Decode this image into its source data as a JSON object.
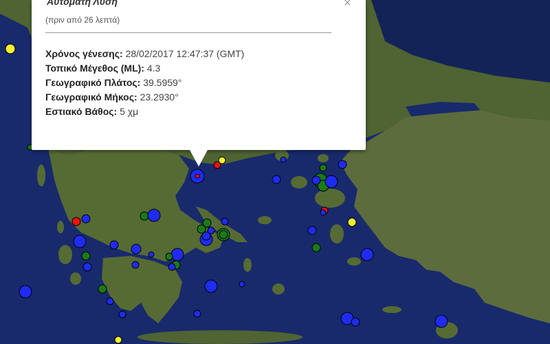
{
  "popup": {
    "title": "Αυτόματη Λύση",
    "subtitle": "(πριν από 26 λεπτά)",
    "close_icon": "close-icon",
    "fields": [
      {
        "label": "Χρόνος γένεσης:",
        "value": "28/02/2017  12:47:37 (GMT)"
      },
      {
        "label": "Τοπικό Μέγεθος (ML):",
        "value": "4.3"
      },
      {
        "label": "Γεωγραφικό Πλάτος:",
        "value": "39.5959°"
      },
      {
        "label": "Γεωγραφικό Μήκος:",
        "value": "23.2930°"
      },
      {
        "label": "Εστιακό Βάθος:",
        "value": "5 χμ"
      }
    ]
  },
  "colors": {
    "sea": "#1a2a6c",
    "land": "#5c6e3a",
    "marker_blue": "#1f2bf2",
    "marker_green": "#1a7a1a",
    "marker_red": "#ee1111",
    "marker_yellow": "#f5f233"
  }
}
